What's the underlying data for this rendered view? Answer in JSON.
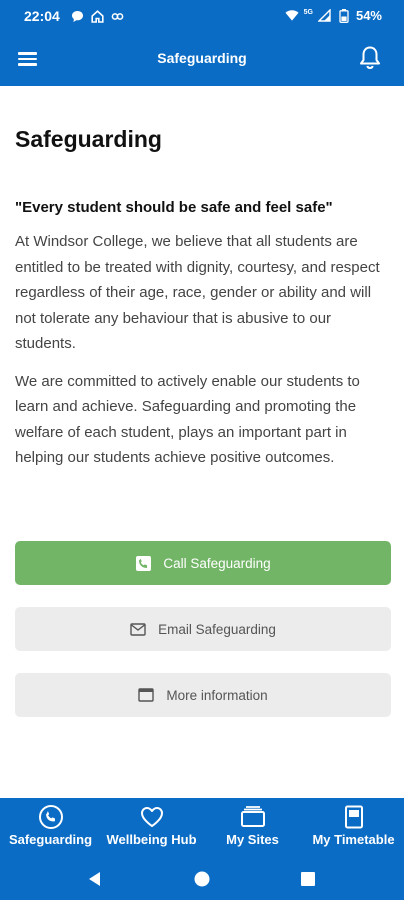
{
  "status_bar": {
    "time": "22:04",
    "battery": "54%",
    "network": "5G"
  },
  "app_bar": {
    "title": "Safeguarding"
  },
  "page": {
    "title": "Safeguarding",
    "quote": "\"Every student should be safe and feel safe\"",
    "paragraph_1": "At Windsor College, we believe that all students are entitled to be treated with dignity, courtesy, and respect regardless of their age, race, gender or ability and will not tolerate any behaviour that is abusive to our students.",
    "paragraph_2": "We are committed to actively enable our students to learn and achieve. Safeguarding and promoting the welfare of each student, plays an important part in helping our students achieve positive outcomes."
  },
  "buttons": {
    "call": "Call Safeguarding",
    "email": "Email Safeguarding",
    "info": "More information"
  },
  "bottom_nav": {
    "items": [
      {
        "label": "Safeguarding",
        "icon": "phone-circle-icon"
      },
      {
        "label": "Wellbeing Hub",
        "icon": "heart-icon"
      },
      {
        "label": "My Sites",
        "icon": "sites-icon"
      },
      {
        "label": "My Timetable",
        "icon": "timetable-icon"
      }
    ]
  },
  "colors": {
    "primary": "#0b6cc5",
    "call_button": "#73b567",
    "secondary_button": "#ececec"
  }
}
